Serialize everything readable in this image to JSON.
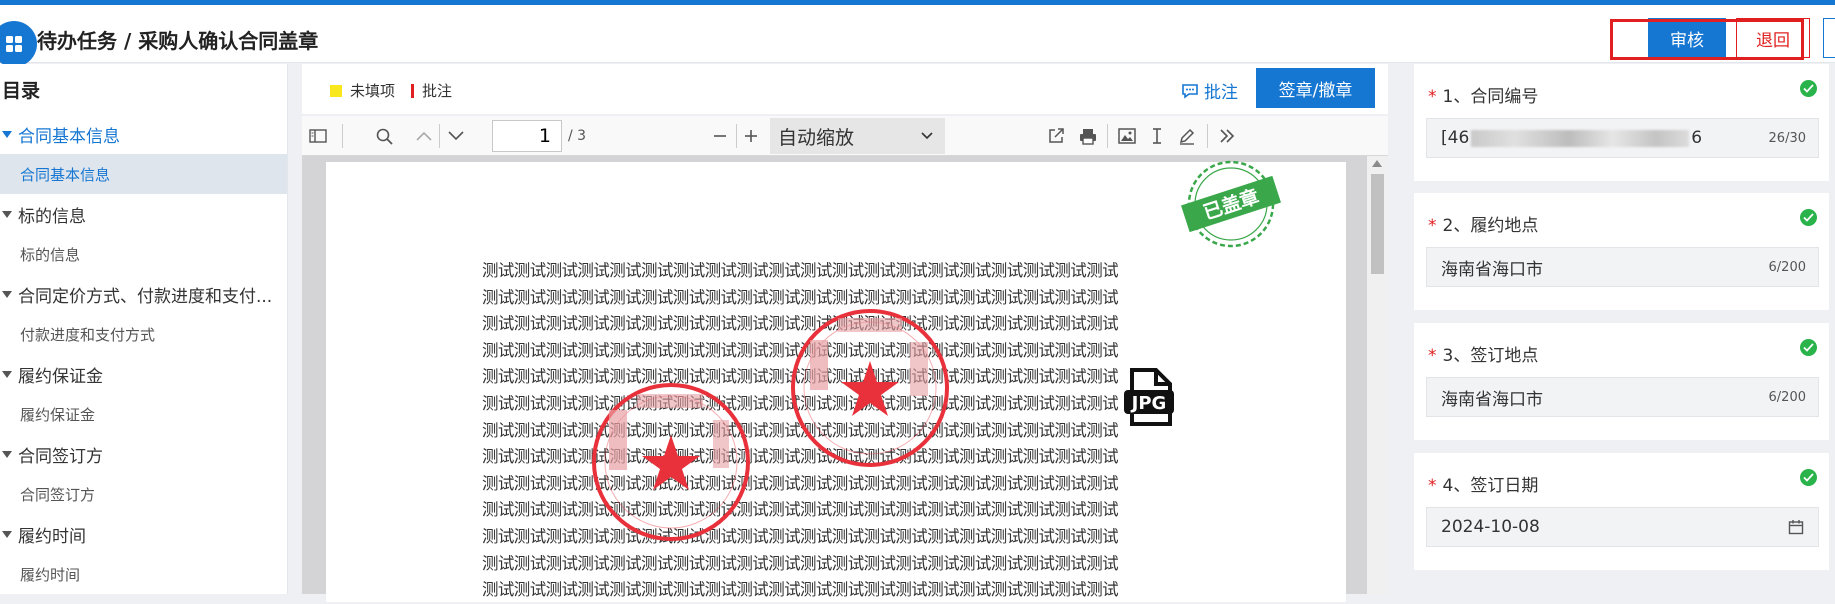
{
  "header": {
    "title": "待办任务 / 采购人确认合同盖章",
    "audit_label": "审核",
    "return_label": "退回"
  },
  "sidebar": {
    "title": "目录",
    "items": [
      {
        "type": "group",
        "label": "合同基本信息",
        "active": true
      },
      {
        "type": "sub",
        "label": "合同基本信息",
        "active": true
      },
      {
        "type": "group",
        "label": "标的信息"
      },
      {
        "type": "sub",
        "label": "标的信息"
      },
      {
        "type": "group",
        "label": "合同定价方式、付款进度和支付..."
      },
      {
        "type": "sub",
        "label": "付款进度和支付方式"
      },
      {
        "type": "group",
        "label": "履约保证金"
      },
      {
        "type": "sub",
        "label": "履约保证金"
      },
      {
        "type": "group",
        "label": "合同签订方"
      },
      {
        "type": "sub",
        "label": "合同签订方"
      },
      {
        "type": "group",
        "label": "履约时间"
      },
      {
        "type": "sub",
        "label": "履约时间"
      }
    ]
  },
  "viewer": {
    "legend_unfilled": "未填项",
    "legend_annotation": "批注",
    "annotate_label": "批注",
    "sign_label": "签章/撤章",
    "page_number": "1",
    "page_total": "/ 3",
    "zoom_label": "自动缩放",
    "stamp_text": "已盖章",
    "jpg_label": "JPG",
    "body_word": "测试",
    "colors": {
      "accent": "#1677d2",
      "danger": "#e02020",
      "stamp": "#e8313b",
      "success": "#29b34a"
    }
  },
  "form": {
    "fields": [
      {
        "number": "1、合同编号",
        "value_prefix": "[46",
        "value_suffix": "6",
        "count": "26/30"
      },
      {
        "number": "2、履约地点",
        "value": "海南省海口市",
        "count": "6/200"
      },
      {
        "number": "3、签订地点",
        "value": "海南省海口市",
        "count": "6/200"
      },
      {
        "number": "4、签订日期",
        "value": "2024-10-08"
      }
    ]
  }
}
